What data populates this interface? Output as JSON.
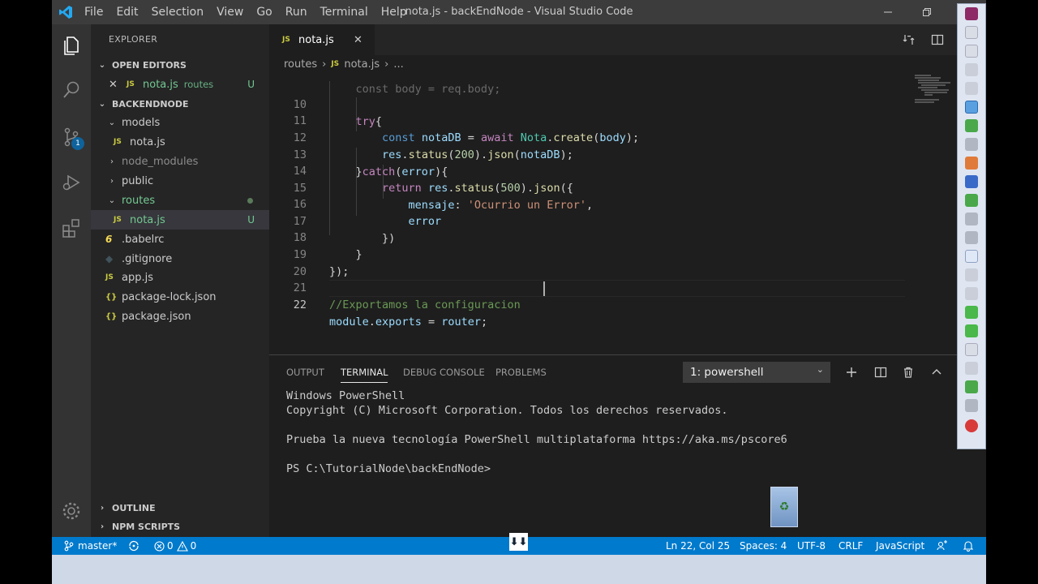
{
  "titlebar": {
    "menu": [
      "File",
      "Edit",
      "Selection",
      "View",
      "Go",
      "Run",
      "Terminal",
      "Help"
    ],
    "title": "nota.js - backEndNode - Visual Studio Code"
  },
  "sidebar": {
    "title": "EXPLORER",
    "open_editors": {
      "label": "OPEN EDITORS",
      "items": [
        {
          "name": "nota.js",
          "folder": "routes",
          "status": "U"
        }
      ]
    },
    "project": {
      "label": "BACKENDNODE",
      "tree": [
        {
          "name": "models",
          "type": "folder",
          "expanded": true
        },
        {
          "name": "nota.js",
          "type": "js"
        },
        {
          "name": "node_modules",
          "type": "folder",
          "expanded": false
        },
        {
          "name": "public",
          "type": "folder",
          "expanded": false
        },
        {
          "name": "routes",
          "type": "folder",
          "expanded": true
        },
        {
          "name": "nota.js",
          "type": "js",
          "status": "U"
        },
        {
          "name": ".babelrc",
          "type": "babel"
        },
        {
          "name": ".gitignore",
          "type": "git"
        },
        {
          "name": "app.js",
          "type": "js"
        },
        {
          "name": "package-lock.json",
          "type": "json"
        },
        {
          "name": "package.json",
          "type": "json"
        }
      ]
    },
    "outline": "OUTLINE",
    "npm_scripts": "NPM SCRIPTS"
  },
  "activity": {
    "scm_badge": "1"
  },
  "editor": {
    "tab": "nota.js",
    "breadcrumb": [
      "routes",
      "nota.js",
      "..."
    ],
    "current_line": "22",
    "lines": [
      {
        "n": "10",
        "text": "    try{"
      },
      {
        "n": "11",
        "text": "        const notaDB = await Nota.create(body);"
      },
      {
        "n": "12",
        "text": "        res.status(200).json(notaDB);"
      },
      {
        "n": "13",
        "text": "    }catch(error){"
      },
      {
        "n": "14",
        "text": "        return res.status(500).json({"
      },
      {
        "n": "15",
        "text": "            mensaje: 'Ocurrio un Error',"
      },
      {
        "n": "16",
        "text": "            error"
      },
      {
        "n": "17",
        "text": "        })"
      },
      {
        "n": "18",
        "text": "    }"
      },
      {
        "n": "19",
        "text": "});"
      },
      {
        "n": "20",
        "text": ""
      },
      {
        "n": "21",
        "text": "//Exportamos la configuracion"
      },
      {
        "n": "22",
        "text": "module.exports = router;"
      }
    ]
  },
  "panel": {
    "tabs": [
      "OUTPUT",
      "TERMINAL",
      "DEBUG CONSOLE",
      "PROBLEMS"
    ],
    "active_tab": "TERMINAL",
    "terminal_select": "1: powershell",
    "terminal_lines": [
      "Windows PowerShell",
      "Copyright (C) Microsoft Corporation. Todos los derechos reservados.",
      "",
      "Prueba la nueva tecnología PowerShell multiplataforma https://aka.ms/pscore6",
      "",
      "PS C:\\TutorialNode\\backEndNode>"
    ]
  },
  "statusbar": {
    "branch": "master*",
    "errors": "0",
    "warnings": "0",
    "position": "Ln 22, Col 25",
    "spaces": "Spaces: 4",
    "encoding": "UTF-8",
    "eol": "CRLF",
    "language": "JavaScript"
  },
  "colors": {
    "accent": "#007acc",
    "untracked": "#73c991",
    "js_icon": "#cbcb41"
  }
}
